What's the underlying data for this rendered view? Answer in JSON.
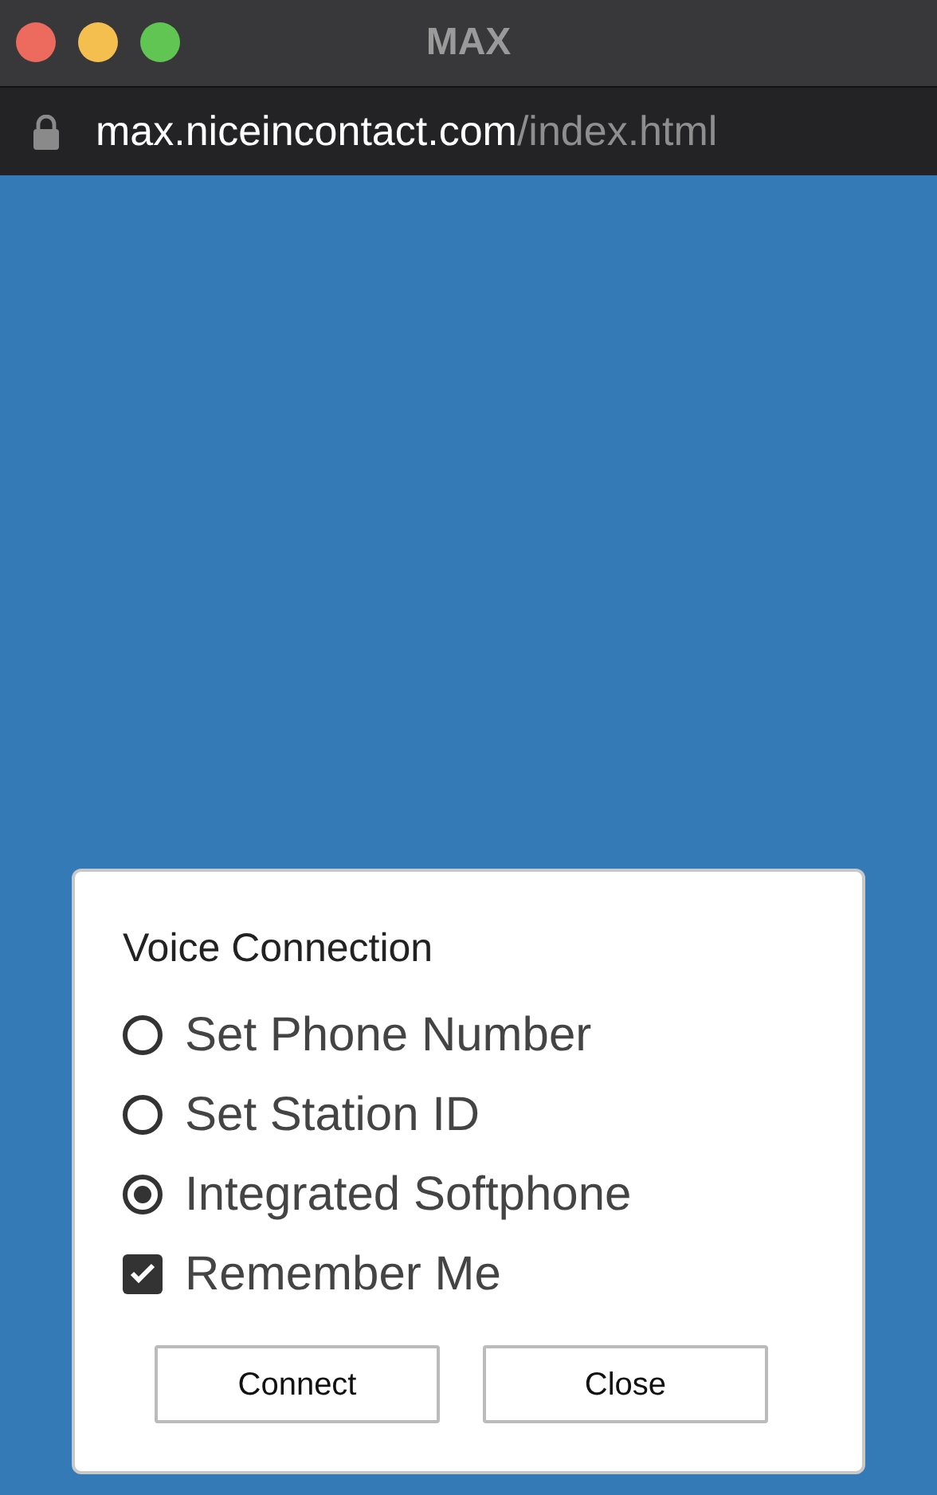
{
  "window": {
    "title": "MAX"
  },
  "address": {
    "host": "max.niceincontact.com",
    "path": "/index.html"
  },
  "dialog": {
    "title": "Voice Connection",
    "options": [
      {
        "label": "Set Phone Number",
        "selected": false
      },
      {
        "label": "Set Station ID",
        "selected": false
      },
      {
        "label": "Integrated Softphone",
        "selected": true
      }
    ],
    "remember": {
      "label": "Remember Me",
      "checked": true
    },
    "buttons": [
      "Connect",
      "Close"
    ]
  }
}
